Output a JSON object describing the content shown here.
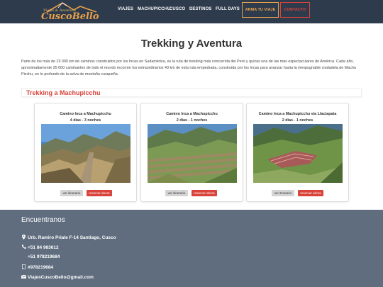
{
  "nav": {
    "logo_tagline": "Viajes & Aventura",
    "logo_text": "CuscoBello",
    "links": [
      "VIAJES",
      "MACHUPICCHU",
      "CUSCO",
      "DESTINOS",
      "FULL DAYS"
    ],
    "arma_tu_viaje": "ARMA TU VIAJE",
    "contacto": "CONTACTO"
  },
  "main": {
    "title": "Trekking y Aventura",
    "intro": "Parte de los más de 23 000 km de caminos construidos por los Incas en Sudamérica, es la ruta de trekking más concurrida del Perú y quizás una de las más espectaculares de América. Cada año, aproximadamente 25 000 caminantes de todo el mundo recorren los extraordinarios 43 km de esta ruta empedrada, construida por los Incas para avanzar hasta la inexpugnable ciudadela de Machu Picchu, en lo profundo de la selva de montaña cusqueña.",
    "section_title": "Trekking a Machupicchu"
  },
  "cards": [
    {
      "title": "Camino Inca a Machupicchu",
      "duration": "4 días - 3 noches",
      "ver_label": "ver itinerario",
      "reservar_label": "reservar ahora"
    },
    {
      "title": "Camino Inca a Machupicchu",
      "duration": "2 días - 1 noches",
      "ver_label": "ver itinerario",
      "reservar_label": "reservar ahora"
    },
    {
      "title": "Camino Inca a Machupicchu vía Llactapata",
      "duration": "2 días - 1 noches",
      "ver_label": "ver itinerario",
      "reservar_label": "reservar ahora"
    }
  ],
  "footer": {
    "title": "Encuentranos",
    "address": "Urb. Ramiro Priale F-14 Santiago, Cusco",
    "phone": "+51 84 983612",
    "mobile": "+51 978219684",
    "whatsapp": "#978219684",
    "email": "ViajesCuscoBello@gmail.com"
  },
  "colors": {
    "navbar": "#2e3b4c",
    "accent_orange": "#e8a14a",
    "accent_red": "#d9433a",
    "footer": "#5f6d7f"
  }
}
